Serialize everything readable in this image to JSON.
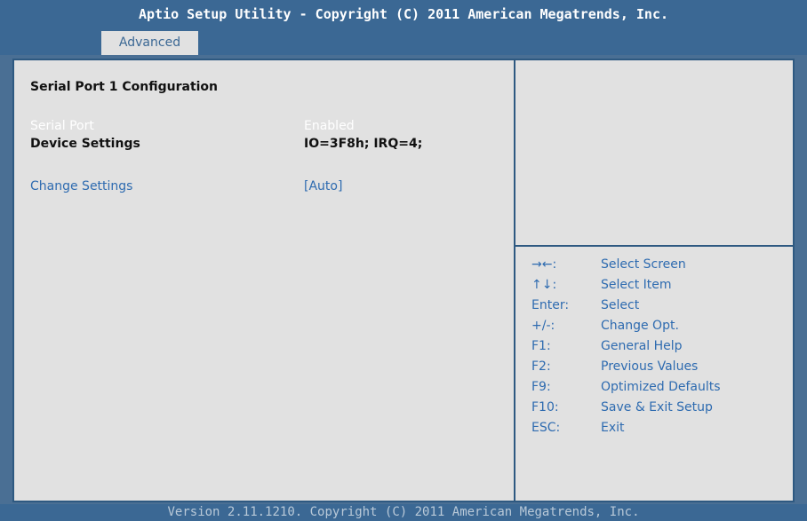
{
  "header": {
    "title": "Aptio Setup Utility - Copyright (C) 2011 American Megatrends, Inc.",
    "tabs": [
      {
        "label": "Advanced"
      }
    ]
  },
  "main": {
    "section_title": "Serial Port 1 Configuration",
    "items": [
      {
        "label": "Serial Port",
        "value": "Enabled"
      },
      {
        "label": "Device Settings",
        "value": "IO=3F8h;  IRQ=4;"
      },
      {
        "label": "Change Settings",
        "value": "[Auto]"
      }
    ]
  },
  "help_panel": {
    "keys": [
      {
        "key": "→←:",
        "description": "Select Screen"
      },
      {
        "key": "↑↓:",
        "description": "Select Item"
      },
      {
        "key": "Enter:",
        "description": "Select"
      },
      {
        "key": "+/-:",
        "description": "Change Opt."
      },
      {
        "key": "F1:",
        "description": "General Help"
      },
      {
        "key": "F2:",
        "description": "Previous Values"
      },
      {
        "key": "F9:",
        "description": "Optimized Defaults"
      },
      {
        "key": "F10:",
        "description": "Save & Exit Setup"
      },
      {
        "key": "ESC:",
        "description": "Exit"
      }
    ]
  },
  "footer": {
    "version_text": "Version 2.11.1210. Copyright (C) 2011 American Megatrends, Inc."
  },
  "colors": {
    "header_bg": "#3b6894",
    "panel_bg": "#e1e1e1",
    "border": "#2e5981",
    "accent_blue": "#2e6bb0",
    "disabled_white": "#ffffff"
  }
}
